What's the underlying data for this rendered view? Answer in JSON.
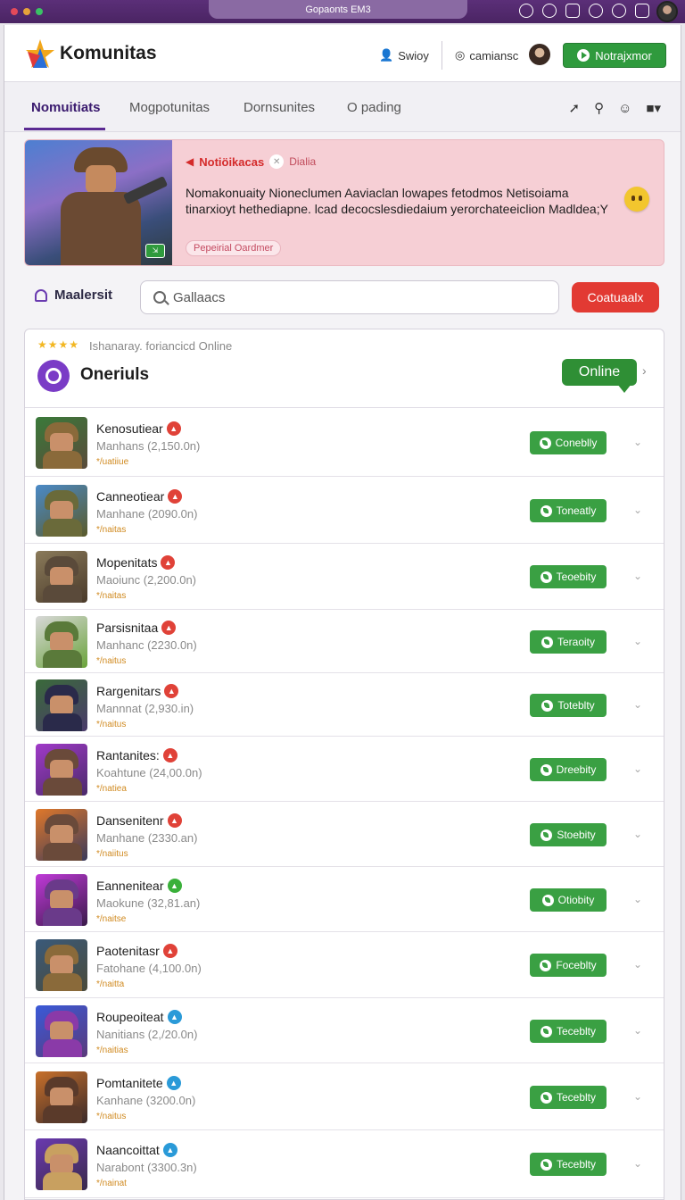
{
  "os": {
    "url": "Gopaonts EM3",
    "dot_colors": [
      "#e34a5a",
      "#e6a23a",
      "#3ac265"
    ]
  },
  "header": {
    "brand": "Komunitas",
    "user_label": "Swioy",
    "cam_label": "camiansc",
    "action_button": "Notrajxmor"
  },
  "tabs": [
    {
      "label": "Nomuitiats",
      "active": true
    },
    {
      "label": "Mogpotunitas",
      "active": false
    },
    {
      "label": "Dornsunites",
      "active": false
    },
    {
      "label": "O pading",
      "active": false
    }
  ],
  "banner": {
    "title": "Notiöikacas",
    "dismiss": "Dialia",
    "text": "Nomakonuaity Nioneclumen Aaviaclan lowapes fetodmos Netisoiama tinarxioyt hethediapne. lcad decocslesdiedaium yerorchateeiclion Madldea;Y",
    "chip": "Pepeirial Oardmer",
    "accent_color": "#d42b2b"
  },
  "search": {
    "label": "Maalersit",
    "value": "Gallaacs",
    "button": "Coatuaalx"
  },
  "panel": {
    "stars": "★★★★",
    "subtitle": "Ishanaray. foriancicd Online",
    "title": "Oneriuls",
    "status": "Online"
  },
  "rows": [
    {
      "name": "Kenosutiear",
      "meta": "Manhans (2,150.0n)",
      "tag": "*/uatiiue",
      "button": "Coneblly",
      "badge_color": "#e04238",
      "thumb": [
        "#3a7a3a",
        "#8a6a3a",
        "#5a4a3a"
      ]
    },
    {
      "name": "Canneotiear",
      "meta": "Manhane (2090.0n)",
      "tag": "*/naitas",
      "button": "Toneatly",
      "badge_color": "#e04238",
      "thumb": [
        "#4a8ac8",
        "#6a6a3a",
        "#5a5a2a"
      ]
    },
    {
      "name": "Mopenitats",
      "meta": "Maoiunc (2,200.0n)",
      "tag": "*/naitas",
      "button": "Teoebity",
      "badge_color": "#e04238",
      "thumb": [
        "#8a7a5a",
        "#5a4a3a",
        "#4a3a2a"
      ]
    },
    {
      "name": "Parsisnitaa",
      "meta": "Manhanc (2230.0n)",
      "tag": "*/naitus",
      "button": "Teraoity",
      "badge_color": "#e04238",
      "thumb": [
        "#d8d8d8",
        "#5a7a3a",
        "#6aa33a"
      ]
    },
    {
      "name": "Rargenitars",
      "meta": "Mannnat (2,930.in)",
      "tag": "*/naitus",
      "button": "Toteblty",
      "badge_color": "#e04238",
      "thumb": [
        "#3a6a3a",
        "#2a2a4a",
        "#4a3a6a"
      ]
    },
    {
      "name": "Rantanites:",
      "meta": "Koahtune (24,00.0n)",
      "tag": "*/natiea",
      "button": "Dreebity",
      "badge_color": "#e04238",
      "thumb": [
        "#a03ac8",
        "#6a4a3a",
        "#4a2a6a"
      ]
    },
    {
      "name": "Dansenitenr",
      "meta": "Manhane (2330.an)",
      "tag": "*/naiitus",
      "button": "Stoebity",
      "badge_color": "#e04238",
      "thumb": [
        "#e0782a",
        "#6a4a3a",
        "#3a3a5a"
      ]
    },
    {
      "name": "Eannenitear",
      "meta": "Maokune (32,81.an)",
      "tag": "*/naitse",
      "button": "Otiobity",
      "badge_color": "#3ab03a",
      "thumb": [
        "#c03ad8",
        "#6a3a8a",
        "#3a1a4a"
      ]
    },
    {
      "name": "Paotenitasr",
      "meta": "Fatohane (4,100.0n)",
      "tag": "*/naitta",
      "button": "Foceblty",
      "badge_color": "#e04238",
      "thumb": [
        "#3a5a7a",
        "#8a6a3a",
        "#4a4a3a"
      ]
    },
    {
      "name": "Roupeoiteat",
      "meta": "Nanitians (2,/20.0n)",
      "tag": "*/naitias",
      "button": "Teceblty",
      "badge_color": "#2a9ad8",
      "thumb": [
        "#3a5ad8",
        "#8a3aa8",
        "#5a3a7a"
      ]
    },
    {
      "name": "Pomtanitete",
      "meta": "Kanhane (3200.0n)",
      "tag": "*/naitus",
      "button": "Teceblty",
      "badge_color": "#2a9ad8",
      "thumb": [
        "#c8702a",
        "#5a3a2a",
        "#3a2a2a"
      ]
    },
    {
      "name": "Naancoittat",
      "meta": "Narabont (3300.3n)",
      "tag": "*/nainat",
      "button": "Teceblty",
      "badge_color": "#2a9ad8",
      "thumb": [
        "#6a3ab0",
        "#c8a060",
        "#3a2a4a"
      ]
    }
  ]
}
